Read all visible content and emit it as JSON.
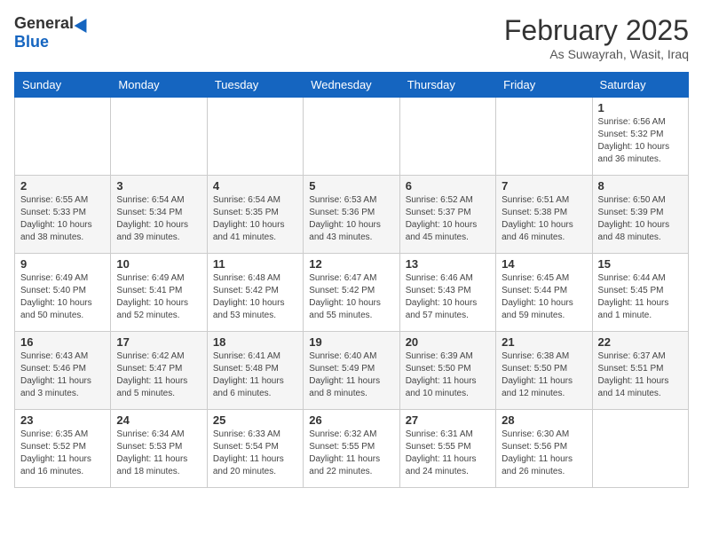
{
  "header": {
    "logo_general": "General",
    "logo_blue": "Blue",
    "month_year": "February 2025",
    "location": "As Suwayrah, Wasit, Iraq"
  },
  "days_of_week": [
    "Sunday",
    "Monday",
    "Tuesday",
    "Wednesday",
    "Thursday",
    "Friday",
    "Saturday"
  ],
  "weeks": [
    [
      {
        "day": "",
        "info": ""
      },
      {
        "day": "",
        "info": ""
      },
      {
        "day": "",
        "info": ""
      },
      {
        "day": "",
        "info": ""
      },
      {
        "day": "",
        "info": ""
      },
      {
        "day": "",
        "info": ""
      },
      {
        "day": "1",
        "info": "Sunrise: 6:56 AM\nSunset: 5:32 PM\nDaylight: 10 hours and 36 minutes."
      }
    ],
    [
      {
        "day": "2",
        "info": "Sunrise: 6:55 AM\nSunset: 5:33 PM\nDaylight: 10 hours and 38 minutes."
      },
      {
        "day": "3",
        "info": "Sunrise: 6:54 AM\nSunset: 5:34 PM\nDaylight: 10 hours and 39 minutes."
      },
      {
        "day": "4",
        "info": "Sunrise: 6:54 AM\nSunset: 5:35 PM\nDaylight: 10 hours and 41 minutes."
      },
      {
        "day": "5",
        "info": "Sunrise: 6:53 AM\nSunset: 5:36 PM\nDaylight: 10 hours and 43 minutes."
      },
      {
        "day": "6",
        "info": "Sunrise: 6:52 AM\nSunset: 5:37 PM\nDaylight: 10 hours and 45 minutes."
      },
      {
        "day": "7",
        "info": "Sunrise: 6:51 AM\nSunset: 5:38 PM\nDaylight: 10 hours and 46 minutes."
      },
      {
        "day": "8",
        "info": "Sunrise: 6:50 AM\nSunset: 5:39 PM\nDaylight: 10 hours and 48 minutes."
      }
    ],
    [
      {
        "day": "9",
        "info": "Sunrise: 6:49 AM\nSunset: 5:40 PM\nDaylight: 10 hours and 50 minutes."
      },
      {
        "day": "10",
        "info": "Sunrise: 6:49 AM\nSunset: 5:41 PM\nDaylight: 10 hours and 52 minutes."
      },
      {
        "day": "11",
        "info": "Sunrise: 6:48 AM\nSunset: 5:42 PM\nDaylight: 10 hours and 53 minutes."
      },
      {
        "day": "12",
        "info": "Sunrise: 6:47 AM\nSunset: 5:42 PM\nDaylight: 10 hours and 55 minutes."
      },
      {
        "day": "13",
        "info": "Sunrise: 6:46 AM\nSunset: 5:43 PM\nDaylight: 10 hours and 57 minutes."
      },
      {
        "day": "14",
        "info": "Sunrise: 6:45 AM\nSunset: 5:44 PM\nDaylight: 10 hours and 59 minutes."
      },
      {
        "day": "15",
        "info": "Sunrise: 6:44 AM\nSunset: 5:45 PM\nDaylight: 11 hours and 1 minute."
      }
    ],
    [
      {
        "day": "16",
        "info": "Sunrise: 6:43 AM\nSunset: 5:46 PM\nDaylight: 11 hours and 3 minutes."
      },
      {
        "day": "17",
        "info": "Sunrise: 6:42 AM\nSunset: 5:47 PM\nDaylight: 11 hours and 5 minutes."
      },
      {
        "day": "18",
        "info": "Sunrise: 6:41 AM\nSunset: 5:48 PM\nDaylight: 11 hours and 6 minutes."
      },
      {
        "day": "19",
        "info": "Sunrise: 6:40 AM\nSunset: 5:49 PM\nDaylight: 11 hours and 8 minutes."
      },
      {
        "day": "20",
        "info": "Sunrise: 6:39 AM\nSunset: 5:50 PM\nDaylight: 11 hours and 10 minutes."
      },
      {
        "day": "21",
        "info": "Sunrise: 6:38 AM\nSunset: 5:50 PM\nDaylight: 11 hours and 12 minutes."
      },
      {
        "day": "22",
        "info": "Sunrise: 6:37 AM\nSunset: 5:51 PM\nDaylight: 11 hours and 14 minutes."
      }
    ],
    [
      {
        "day": "23",
        "info": "Sunrise: 6:35 AM\nSunset: 5:52 PM\nDaylight: 11 hours and 16 minutes."
      },
      {
        "day": "24",
        "info": "Sunrise: 6:34 AM\nSunset: 5:53 PM\nDaylight: 11 hours and 18 minutes."
      },
      {
        "day": "25",
        "info": "Sunrise: 6:33 AM\nSunset: 5:54 PM\nDaylight: 11 hours and 20 minutes."
      },
      {
        "day": "26",
        "info": "Sunrise: 6:32 AM\nSunset: 5:55 PM\nDaylight: 11 hours and 22 minutes."
      },
      {
        "day": "27",
        "info": "Sunrise: 6:31 AM\nSunset: 5:55 PM\nDaylight: 11 hours and 24 minutes."
      },
      {
        "day": "28",
        "info": "Sunrise: 6:30 AM\nSunset: 5:56 PM\nDaylight: 11 hours and 26 minutes."
      },
      {
        "day": "",
        "info": ""
      }
    ]
  ]
}
